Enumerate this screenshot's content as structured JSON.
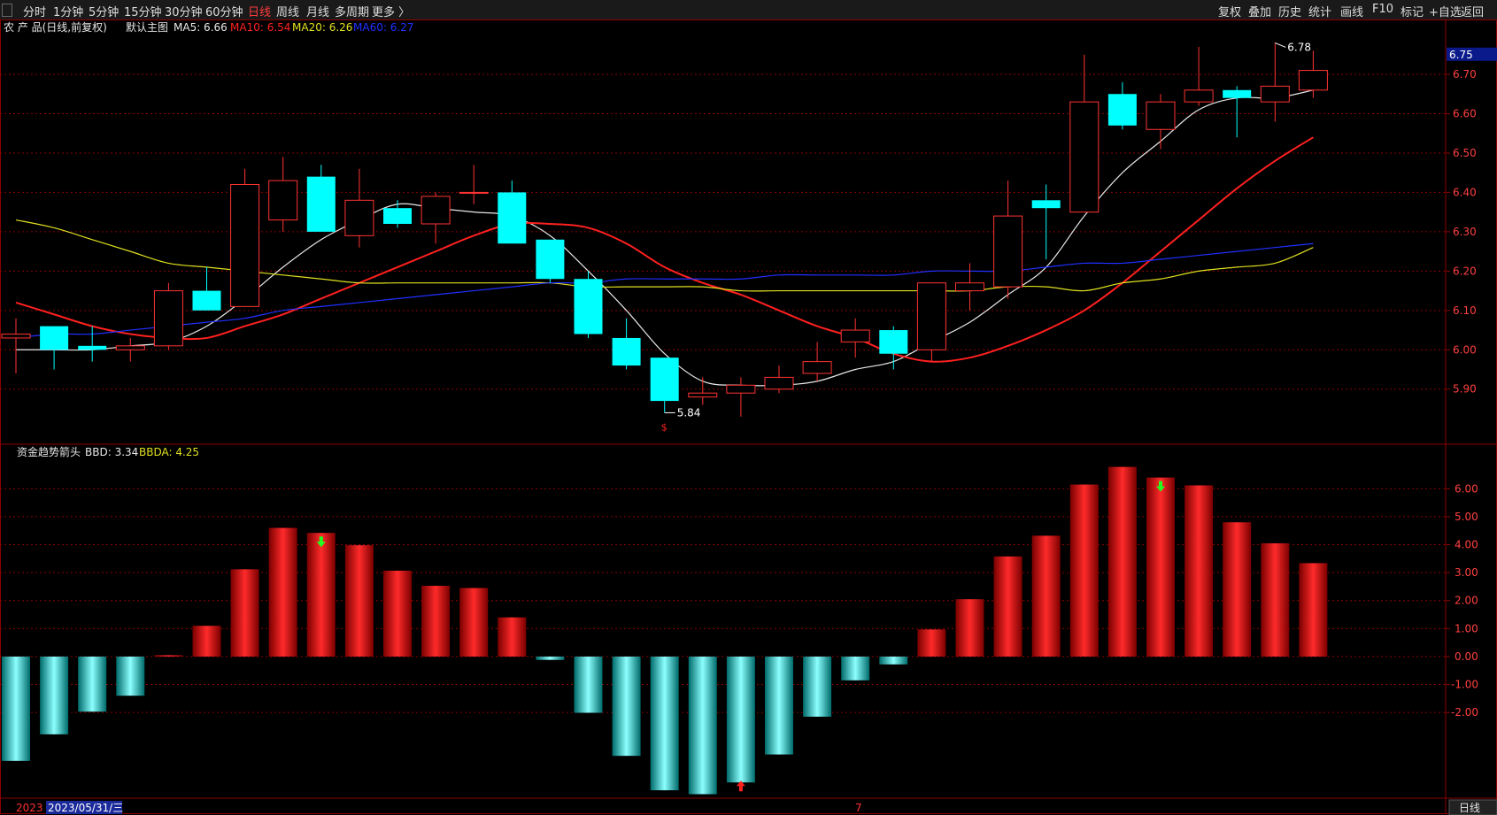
{
  "toolbar": {
    "left": [
      "分时",
      "1分钟",
      "5分钟",
      "15分钟",
      "30分钟",
      "60分钟",
      "日线",
      "周线",
      "月线",
      "多周期",
      "更多 〉"
    ],
    "active": "日线",
    "right": [
      "复权",
      "叠加",
      "历史",
      "统计",
      "画线",
      "F10",
      "标记",
      "+自选",
      "返回"
    ]
  },
  "header": {
    "title": "农 产 品(日线,前复权)",
    "main_label": "默认主图",
    "ma5": "MA5: 6.66",
    "ma10": "MA10: 6.54",
    "ma20": "MA20: 6.26",
    "ma60": "MA60: 6.27"
  },
  "sub_header": {
    "title": "资金趋势箭头",
    "bbd": "BBD: 3.34",
    "bbda": "BBDA: 4.25"
  },
  "colors": {
    "up": "#ff3333",
    "down": "#00ffff",
    "ma5": "#e8e8e8",
    "ma10": "#ff2020",
    "ma20": "#e0e020",
    "ma60": "#2030ff",
    "grid": "#8b0000",
    "axis_text": "#ff4040"
  },
  "footer": {
    "date_tag": "2023",
    "date_cursor": "2023/05/31/三",
    "month_marker": "7",
    "period_button": "日线"
  },
  "chart_data": [
    {
      "type": "candlestick",
      "title": "农 产 品(日线,前复权)",
      "ylim": [
        5.76,
        6.79
      ],
      "yticks": [
        5.9,
        6.0,
        6.1,
        6.2,
        6.3,
        6.4,
        6.5,
        6.6,
        6.7
      ],
      "last_price_label": "6.75",
      "candles": [
        {
          "o": 6.03,
          "h": 6.08,
          "l": 5.94,
          "c": 6.04
        },
        {
          "o": 6.06,
          "h": 6.06,
          "l": 5.95,
          "c": 6.0
        },
        {
          "o": 6.01,
          "h": 6.06,
          "l": 5.97,
          "c": 6.0
        },
        {
          "o": 6.0,
          "h": 6.03,
          "l": 5.97,
          "c": 6.01
        },
        {
          "o": 6.01,
          "h": 6.17,
          "l": 6.0,
          "c": 6.15
        },
        {
          "o": 6.15,
          "h": 6.21,
          "l": 6.1,
          "c": 6.1
        },
        {
          "o": 6.11,
          "h": 6.46,
          "l": 6.11,
          "c": 6.42
        },
        {
          "o": 6.33,
          "h": 6.49,
          "l": 6.3,
          "c": 6.43
        },
        {
          "o": 6.44,
          "h": 6.47,
          "l": 6.3,
          "c": 6.3
        },
        {
          "o": 6.29,
          "h": 6.46,
          "l": 6.26,
          "c": 6.38
        },
        {
          "o": 6.36,
          "h": 6.38,
          "l": 6.31,
          "c": 6.32
        },
        {
          "o": 6.32,
          "h": 6.4,
          "l": 6.27,
          "c": 6.39
        },
        {
          "o": 6.4,
          "h": 6.47,
          "l": 6.37,
          "c": 6.4
        },
        {
          "o": 6.4,
          "h": 6.43,
          "l": 6.27,
          "c": 6.27
        },
        {
          "o": 6.28,
          "h": 6.28,
          "l": 6.17,
          "c": 6.18
        },
        {
          "o": 6.18,
          "h": 6.2,
          "l": 6.03,
          "c": 6.04
        },
        {
          "o": 6.03,
          "h": 6.08,
          "l": 5.95,
          "c": 5.96
        },
        {
          "o": 5.98,
          "h": 5.98,
          "l": 5.84,
          "c": 5.87
        },
        {
          "o": 5.88,
          "h": 5.93,
          "l": 5.86,
          "c": 5.89
        },
        {
          "o": 5.89,
          "h": 5.93,
          "l": 5.83,
          "c": 5.91
        },
        {
          "o": 5.9,
          "h": 5.96,
          "l": 5.89,
          "c": 5.93
        },
        {
          "o": 5.94,
          "h": 6.02,
          "l": 5.92,
          "c": 5.97
        },
        {
          "o": 6.02,
          "h": 6.08,
          "l": 5.98,
          "c": 6.05
        },
        {
          "o": 6.05,
          "h": 6.06,
          "l": 5.95,
          "c": 5.99
        },
        {
          "o": 6.0,
          "h": 6.17,
          "l": 5.97,
          "c": 6.17
        },
        {
          "o": 6.15,
          "h": 6.22,
          "l": 6.1,
          "c": 6.17
        },
        {
          "o": 6.16,
          "h": 6.43,
          "l": 6.13,
          "c": 6.34
        },
        {
          "o": 6.38,
          "h": 6.42,
          "l": 6.23,
          "c": 6.36
        },
        {
          "o": 6.35,
          "h": 6.75,
          "l": 6.35,
          "c": 6.63
        },
        {
          "o": 6.65,
          "h": 6.68,
          "l": 6.56,
          "c": 6.57
        },
        {
          "o": 6.56,
          "h": 6.65,
          "l": 6.51,
          "c": 6.63
        },
        {
          "o": 6.63,
          "h": 6.77,
          "l": 6.62,
          "c": 6.66
        },
        {
          "o": 6.66,
          "h": 6.67,
          "l": 6.54,
          "c": 6.64
        },
        {
          "o": 6.63,
          "h": 6.78,
          "l": 6.58,
          "c": 6.67
        },
        {
          "o": 6.66,
          "h": 6.76,
          "l": 6.64,
          "c": 6.71
        }
      ],
      "ma_lines": {
        "MA5": [
          6.0,
          6.0,
          6.0,
          6.01,
          6.02,
          6.06,
          6.13,
          6.21,
          6.28,
          6.33,
          6.37,
          6.36,
          6.35,
          6.34,
          6.29,
          6.2,
          6.1,
          5.99,
          5.92,
          5.91,
          5.91,
          5.92,
          5.95,
          5.97,
          6.02,
          6.07,
          6.14,
          6.21,
          6.34,
          6.45,
          6.53,
          6.61,
          6.64,
          6.64,
          6.66
        ],
        "MA10": [
          6.12,
          6.09,
          6.06,
          6.04,
          6.03,
          6.03,
          6.06,
          6.09,
          6.13,
          6.17,
          6.21,
          6.25,
          6.29,
          6.32,
          6.32,
          6.31,
          6.27,
          6.21,
          6.17,
          6.14,
          6.1,
          6.06,
          6.03,
          5.99,
          5.97,
          5.98,
          6.01,
          6.05,
          6.1,
          6.17,
          6.25,
          6.33,
          6.41,
          6.48,
          6.54
        ],
        "MA20": [
          6.33,
          6.31,
          6.28,
          6.25,
          6.22,
          6.21,
          6.2,
          6.19,
          6.18,
          6.17,
          6.17,
          6.17,
          6.17,
          6.17,
          6.17,
          6.16,
          6.16,
          6.16,
          6.16,
          6.15,
          6.15,
          6.15,
          6.15,
          6.15,
          6.15,
          6.15,
          6.16,
          6.16,
          6.15,
          6.17,
          6.18,
          6.2,
          6.21,
          6.22,
          6.26
        ],
        "MA60": [
          6.03,
          6.04,
          6.04,
          6.05,
          6.06,
          6.07,
          6.08,
          6.1,
          6.11,
          6.12,
          6.13,
          6.14,
          6.15,
          6.16,
          6.17,
          6.17,
          6.18,
          6.18,
          6.18,
          6.18,
          6.19,
          6.19,
          6.19,
          6.19,
          6.2,
          6.2,
          6.2,
          6.21,
          6.22,
          6.22,
          6.23,
          6.24,
          6.25,
          6.26,
          6.27
        ]
      },
      "low_marker": "5.84",
      "high_marker": "6.78"
    },
    {
      "type": "bar",
      "title": "资金趋势箭头",
      "ylim": [
        -5.0,
        6.8
      ],
      "yticks": [
        -2.0,
        -1.0,
        0.0,
        1.0,
        2.0,
        3.0,
        4.0,
        5.0,
        6.0
      ],
      "values": [
        -3.73,
        -2.78,
        -1.97,
        -1.4,
        0.05,
        1.1,
        3.12,
        4.6,
        4.42,
        3.98,
        3.07,
        2.53,
        2.45,
        1.4,
        -0.12,
        -2.01,
        -3.55,
        -4.78,
        -4.92,
        -4.5,
        -3.5,
        -2.15,
        -0.85,
        -0.28,
        0.97,
        2.05,
        3.58,
        4.32,
        6.15,
        6.78,
        6.4,
        6.12,
        4.8,
        4.05,
        3.34
      ],
      "arrows": [
        {
          "index": 8,
          "dir": "down",
          "color": "#20ff20"
        },
        {
          "index": 19,
          "dir": "up",
          "color": "#ff2020"
        },
        {
          "index": 30,
          "dir": "down",
          "color": "#20ff20"
        }
      ]
    }
  ]
}
